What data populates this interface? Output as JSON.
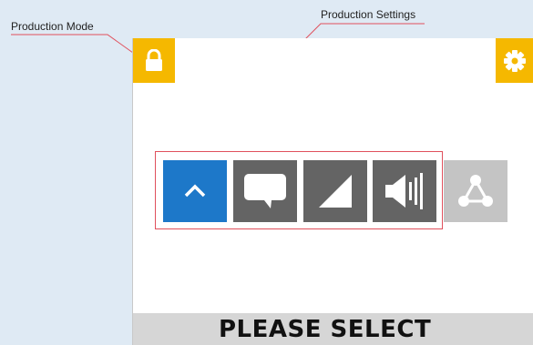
{
  "callouts": {
    "production_mode": "Production Mode",
    "production_settings": "Production Settings"
  },
  "toolbar": {
    "lock_icon": "lock-icon",
    "gear_icon": "gear-icon"
  },
  "settings_row": {
    "items": [
      {
        "icon": "chevron-up-icon",
        "state": "selected",
        "color": "#1d78c9"
      },
      {
        "icon": "speech-bubble-icon",
        "state": "normal",
        "color": "#646464"
      },
      {
        "icon": "contrast-triangle-icon",
        "state": "normal",
        "color": "#646464"
      },
      {
        "icon": "speaker-volume-icon",
        "state": "normal",
        "color": "#646464"
      },
      {
        "icon": "network-share-icon",
        "state": "disabled",
        "color": "#c4c4c4"
      }
    ]
  },
  "status": {
    "prompt": "PLEASE SELECT"
  },
  "colors": {
    "accent": "#f5b800",
    "selected": "#1d78c9",
    "callout_line": "#e0505c"
  }
}
